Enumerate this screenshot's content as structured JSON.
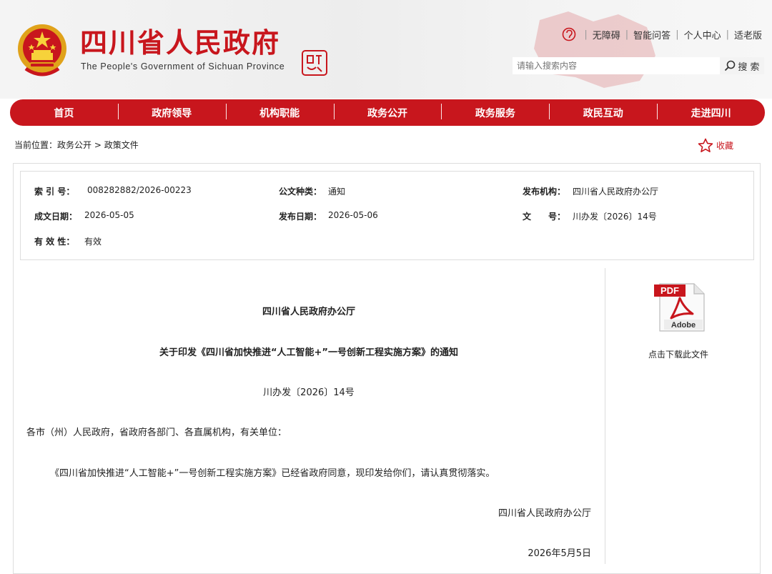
{
  "header": {
    "site_title": "四川省人民政府",
    "site_subtitle": "The People's Government of Sichuan Province",
    "top_links": [
      "无障碍",
      "智能问答",
      "个人中心",
      "适老版"
    ],
    "search_placeholder": "请输入搜索内容",
    "search_button": "搜 索",
    "brand_color": "#c8161d"
  },
  "nav": {
    "items": [
      "首页",
      "政府领导",
      "机构职能",
      "政务公开",
      "政务服务",
      "政民互动",
      "走进四川"
    ]
  },
  "breadcrumb": {
    "prefix": "当前位置：",
    "path": "政务公开 > 政策文件"
  },
  "favorite_label": "收藏",
  "info": {
    "index_label": "索 引 号：",
    "index_value": "008282882/2026-00223",
    "type_label": "公文种类：",
    "type_value": "通知",
    "org_label": "发布机构：",
    "org_value": "四川省人民政府办公厅",
    "written_label": "成文日期：",
    "written_value": "2026-05-05",
    "publish_label": "发布日期：",
    "publish_value": "2026-05-06",
    "docno_label": "文　　号：",
    "docno_value": "川办发〔2026〕14号",
    "valid_label": "有 效 性：",
    "valid_value": "有效"
  },
  "article": {
    "org": "四川省人民政府办公厅",
    "title": "关于印发《四川省加快推进“人工智能+”一号创新工程实施方案》的通知",
    "doc_no": "川办发〔2026〕14号",
    "addressee": "各市（州）人民政府，省政府各部门、各直属机构，有关单位：",
    "body": "《四川省加快推进“人工智能+”一号创新工程实施方案》已经省政府同意，现印发给你们，请认真贯彻落实。",
    "signature": "四川省人民政府办公厅",
    "date": "2026年5月5日"
  },
  "download": {
    "label": "点击下载此文件",
    "icon_text": "PDF",
    "brand_text": "Adobe"
  }
}
